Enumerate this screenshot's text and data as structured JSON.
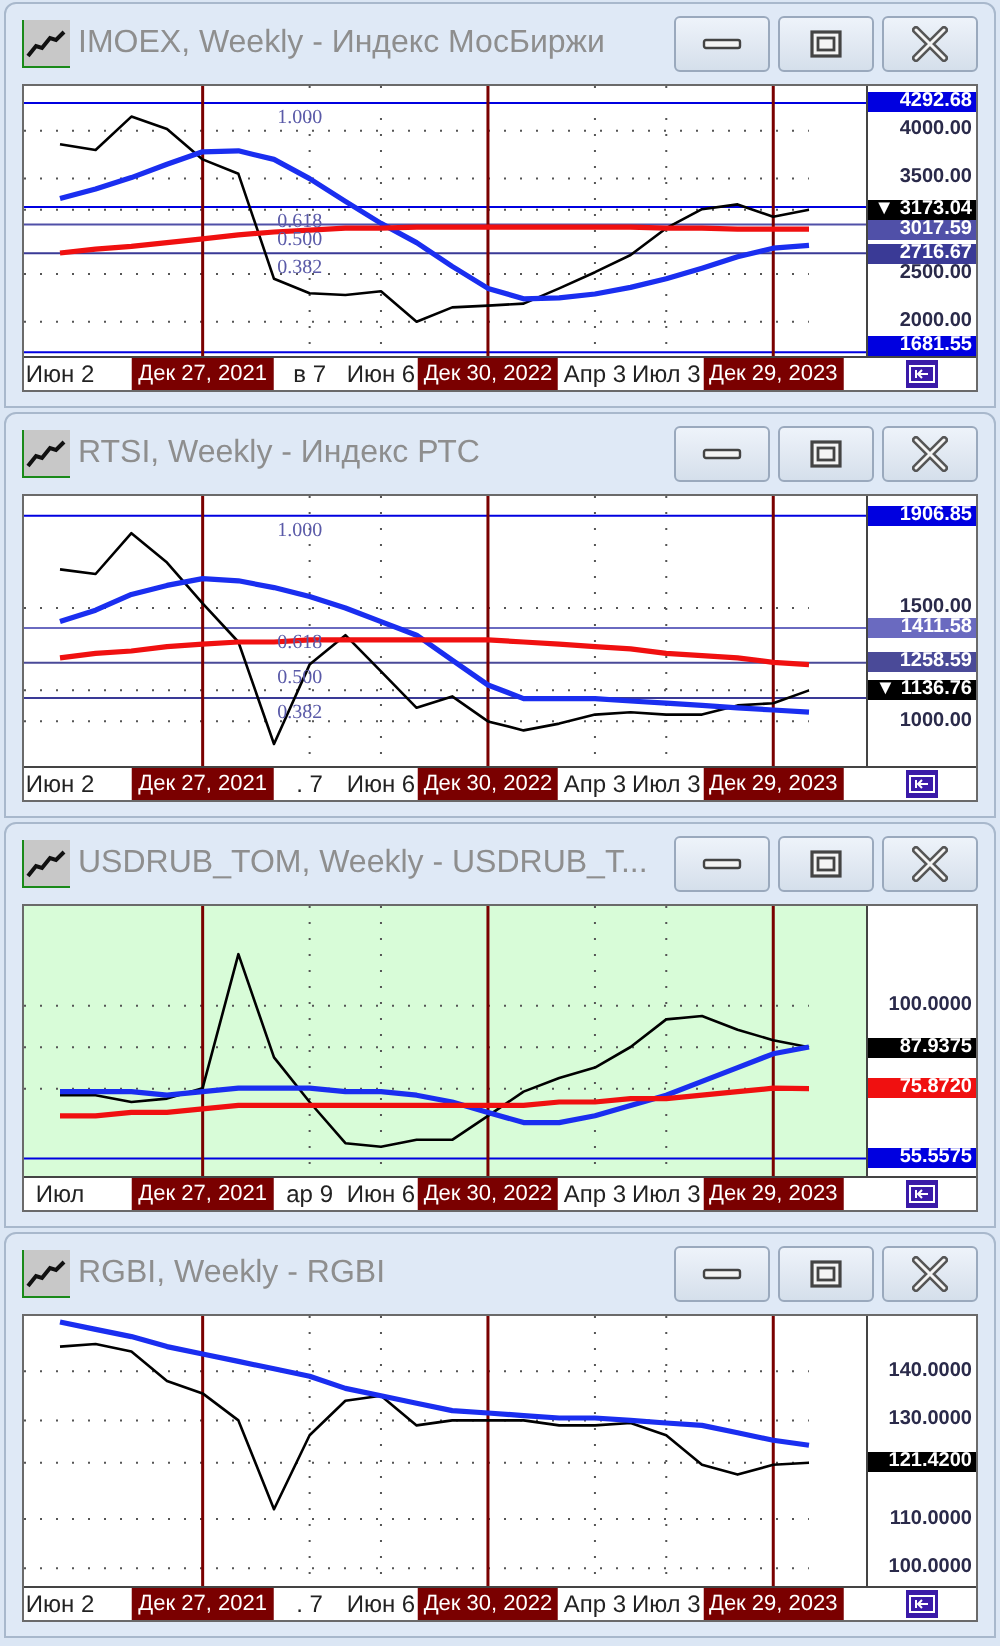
{
  "windows": [
    {
      "title": "IMOEX, Weekly - Индекс МосБиржи",
      "color": "#ffffff",
      "chart_data": {
        "type": "line",
        "ylim": [
          1620,
          4470
        ],
        "grid": true,
        "categories": [
          "Июн 2",
          null,
          null,
          null,
          "Дек 27, 2021",
          null,
          null,
          "в 7",
          null,
          "Июн 6",
          null,
          null,
          "Дек 30, 2022",
          null,
          null,
          "Апр 3",
          null,
          "Июл 3",
          null,
          null,
          "Дек 29, 2023",
          null
        ],
        "series": [
          {
            "color": "#000000",
            "values": [
              3860,
              3800,
              4150,
              4020,
              3700,
              3550,
              2450,
              2300,
              2280,
              2320,
              2000,
              2150,
              2170,
              2190,
              2350,
              2520,
              2700,
              2980,
              3180,
              3230,
              3100,
              3173.04
            ]
          },
          {
            "color": "#1a2ef0",
            "values": [
              3290,
              3390,
              3510,
              3650,
              3780,
              3790,
              3700,
              3500,
              3260,
              3030,
              2830,
              2580,
              2350,
              2240,
              2250,
              2290,
              2360,
              2450,
              2560,
              2680,
              2770,
              2800
            ]
          },
          {
            "color": "#f01010",
            "values": [
              2720,
              2760,
              2790,
              2830,
              2870,
              2910,
              2940,
              2960,
              2980,
              2980,
              2990,
              2990,
              2990,
              2990,
              2990,
              2990,
              2990,
              2980,
              2980,
              2970,
              2970,
              2970
            ]
          }
        ],
        "yticks": [
          {
            "value": 4000,
            "label": "4000.00"
          },
          {
            "value": 3500,
            "label": "3500.00"
          },
          {
            "value": 3173.04,
            "label": "▼ 3173.04"
          },
          {
            "value": 2500,
            "label": "2500.00"
          },
          {
            "value": 2000,
            "label": "2000.00"
          }
        ],
        "ref_lines": [
          {
            "axis": "y",
            "value": 4292.68,
            "label": "4292.68",
            "color": "#0000e0"
          },
          {
            "axis": "y",
            "value": 3201.88,
            "color": "#0000e0"
          },
          {
            "axis": "y",
            "value": 3017.59,
            "label": "3017.59",
            "color": "#5050a8"
          },
          {
            "axis": "y",
            "value": 2716.67,
            "label": "2716.67",
            "color": "#3a3a96"
          },
          {
            "axis": "y",
            "value": 1681.55,
            "label": "1681.55",
            "color": "#0000e0"
          },
          {
            "axis": "x",
            "value": "Дек 27, 2021",
            "color": "#7a0000"
          },
          {
            "axis": "x",
            "value": "Дек 30, 2022",
            "color": "#7a0000"
          },
          {
            "axis": "x",
            "value": "Дек 29, 2023",
            "color": "#7a0000"
          }
        ],
        "annotations": [
          "1.000",
          "0.618",
          "0.500",
          "0.382"
        ]
      }
    },
    {
      "title": "RTSI, Weekly - Индекс РТС",
      "color": "#ffffff",
      "chart_data": {
        "type": "line",
        "ylim": [
          794,
          1994
        ],
        "grid": true,
        "categories": [
          "Июн 2",
          null,
          null,
          null,
          "Дек 27, 2021",
          null,
          null,
          ". 7",
          null,
          "Июн 6",
          null,
          null,
          "Дек 30, 2022",
          null,
          null,
          "Апр 3",
          null,
          "Июл 3",
          null,
          null,
          "Дек 29, 2023",
          null
        ],
        "series": [
          {
            "color": "#000000",
            "values": [
              1670,
              1650,
              1830,
              1700,
              1520,
              1350,
              900,
              1250,
              1380,
              1220,
              1060,
              1110,
              1000,
              960,
              990,
              1030,
              1040,
              1030,
              1030,
              1070,
              1080,
              1136.76
            ]
          },
          {
            "color": "#1a2ef0",
            "values": [
              1440,
              1490,
              1560,
              1600,
              1630,
              1620,
              1590,
              1550,
              1500,
              1440,
              1380,
              1270,
              1160,
              1100,
              1100,
              1100,
              1090,
              1080,
              1070,
              1060,
              1050,
              1040
            ]
          },
          {
            "color": "#f01010",
            "values": [
              1280,
              1300,
              1310,
              1330,
              1340,
              1350,
              1350,
              1360,
              1360,
              1360,
              1360,
              1360,
              1360,
              1350,
              1340,
              1330,
              1320,
              1300,
              1290,
              1280,
              1260,
              1250
            ]
          }
        ],
        "yticks": [
          {
            "value": 1500,
            "label": "1500.00"
          },
          {
            "value": 1136.76,
            "label": "▼ 1136.76"
          },
          {
            "value": 1000,
            "label": "1000.00"
          }
        ],
        "ref_lines": [
          {
            "axis": "y",
            "value": 1906.85,
            "label": "1906.85",
            "color": "#0000e0"
          },
          {
            "axis": "y",
            "value": 1411.58,
            "label": "1411.58",
            "color": "#6a6ac0"
          },
          {
            "axis": "y",
            "value": 1258.59,
            "label": "1258.59",
            "color": "#4a4a98"
          },
          {
            "axis": "y",
            "value": 1103,
            "color": "#3a3a96"
          },
          {
            "axis": "x",
            "value": "Дек 27, 2021",
            "color": "#7a0000"
          },
          {
            "axis": "x",
            "value": "Дек 30, 2022",
            "color": "#7a0000"
          },
          {
            "axis": "x",
            "value": "Дек 29, 2023",
            "color": "#7a0000"
          }
        ],
        "annotations": [
          "1.000",
          "0.618",
          "0.500",
          "0.382"
        ]
      }
    },
    {
      "title": "USDRUB_TOM, Weekly - USDRUB_T...",
      "color": "#d8fcd8",
      "chart_data": {
        "type": "line",
        "ylim": [
          49.9,
          129
        ],
        "grid": true,
        "categories": [
          "Июл",
          null,
          null,
          null,
          "Дек 27, 2021",
          null,
          null,
          "ар 9",
          null,
          "Июн 6",
          null,
          null,
          "Дек 30, 2022",
          null,
          null,
          "Апр 3",
          null,
          "Июл 3",
          null,
          null,
          "Дек 29, 2023",
          null
        ],
        "series": [
          {
            "color": "#000000",
            "values": [
              74,
              74,
              72,
              73,
              76,
              115,
              85,
              72,
              60,
              59,
              61,
              61,
              68,
              75,
              79,
              82,
              88,
              96,
              97,
              93,
              90,
              87.9375
            ]
          },
          {
            "color": "#1a2ef0",
            "values": [
              75,
              75,
              75,
              74,
              75,
              76,
              76,
              76,
              75,
              75,
              74,
              72,
              69,
              66,
              66,
              68,
              71,
              74,
              78,
              82,
              86,
              88
            ]
          },
          {
            "color": "#f01010",
            "values": [
              68,
              68,
              69,
              69,
              70,
              71,
              71,
              71,
              71,
              71,
              71,
              71,
              71,
              71,
              72,
              72,
              73,
              73,
              74,
              75,
              76,
              75.872
            ]
          }
        ],
        "yticks": [
          {
            "value": 100,
            "label": "100.0000"
          },
          {
            "value": 87.9375,
            "label": "87.9375"
          },
          {
            "value": 75.872,
            "label": "75.8720"
          }
        ],
        "ref_lines": [
          {
            "axis": "y",
            "value": 55.5575,
            "label": "55.5575",
            "color": "#0000e0"
          },
          {
            "axis": "x",
            "value": "Дек 27, 2021",
            "color": "#7a0000"
          },
          {
            "axis": "x",
            "value": "Дек 30, 2022",
            "color": "#7a0000"
          },
          {
            "axis": "x",
            "value": "Дек 29, 2023",
            "color": "#7a0000"
          }
        ]
      }
    },
    {
      "title": "RGBI, Weekly - RGBI",
      "color": "#ffffff",
      "chart_data": {
        "type": "line",
        "ylim": [
          96,
          151.2
        ],
        "grid": true,
        "categories": [
          "Июн 2",
          null,
          null,
          null,
          "Дек 27, 2021",
          null,
          null,
          ". 7",
          null,
          "Июн 6",
          null,
          null,
          "Дек 30, 2022",
          null,
          null,
          "Апр 3",
          null,
          "Июл 3",
          null,
          null,
          "Дек 29, 2023",
          null
        ],
        "series": [
          {
            "color": "#000000",
            "values": [
              145,
              145.5,
              144,
              138,
              135.5,
              130,
              112,
              127,
              134,
              135,
              129,
              130,
              130,
              130,
              129,
              129,
              129.5,
              127,
              121,
              119,
              121,
              121.42
            ]
          },
          {
            "color": "#1a2ef0",
            "values": [
              150,
              148.5,
              147,
              145,
              143.5,
              142,
              140.5,
              139,
              136.5,
              135,
              133.5,
              132,
              131.5,
              131,
              130.5,
              130.5,
              130,
              129.5,
              129,
              127.5,
              126,
              125
            ]
          }
        ],
        "yticks": [
          {
            "value": 140,
            "label": "140.0000"
          },
          {
            "value": 130,
            "label": "130.0000"
          },
          {
            "value": 121.42,
            "label": "121.4200"
          },
          {
            "value": 110,
            "label": "110.0000"
          },
          {
            "value": 100,
            "label": "100.0000"
          }
        ],
        "ref_lines": [
          {
            "axis": "x",
            "value": "Дек 27, 2021",
            "color": "#7a0000"
          },
          {
            "axis": "x",
            "value": "Дек 30, 2022",
            "color": "#7a0000"
          },
          {
            "axis": "x",
            "value": "Дек 29, 2023",
            "color": "#7a0000"
          }
        ]
      }
    }
  ]
}
